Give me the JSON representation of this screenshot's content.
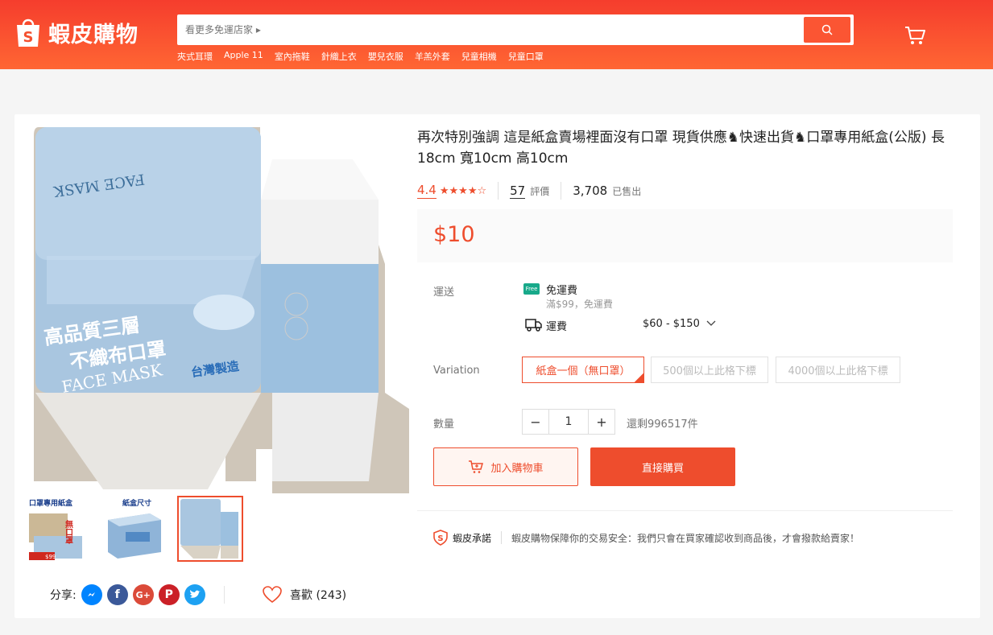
{
  "header": {
    "brand_name": "蝦皮購物",
    "search_placeholder": "看更多免運店家 ▸",
    "hot_words": [
      "夾式耳環",
      "Apple 11",
      "室內拖鞋",
      "針織上衣",
      "嬰兒衣服",
      "羊羔外套",
      "兒童相機",
      "兒童口罩"
    ],
    "brand_color": "#ee4d2d"
  },
  "product": {
    "title": "再次特別強調 這是紙盒賣場裡面沒有口罩 現貨供應♞快速出貨♞口罩專用紙盒(公版) 長18cm 寬10cm 高10cm",
    "rating": "4.4",
    "stars": "★★★★☆",
    "review_count": "57",
    "review_label": "評價",
    "sold_count": "3,708",
    "sold_label": "已售出",
    "price": "$10",
    "image_texts": {
      "face_mask": "FACE MASK",
      "high_quality": "高品質三層",
      "non_woven": "不織布口罩",
      "made_in_taiwan": "台灣製造"
    },
    "thumbnails": [
      {
        "line1": "口罩專用紙盒",
        "line2": "無口罩",
        "price_tag": "$99"
      },
      {
        "line1": "紙盒尺寸"
      },
      {
        "line1": ""
      }
    ]
  },
  "shipping": {
    "label": "運送",
    "free_badge": "Free",
    "free_text": "免運費",
    "free_sub": "滿$99，免運費",
    "fee_label": "運費",
    "fee_range": "$60 - $150"
  },
  "variation": {
    "label": "Variation",
    "options": [
      "紙盒一個（無口罩）",
      "500個以上此格下標",
      "4000個以上此格下標"
    ],
    "selected": 0
  },
  "quantity": {
    "label": "數量",
    "minus": "−",
    "value": "1",
    "plus": "+",
    "stock": "還剩996517件"
  },
  "actions": {
    "add_to_cart": "加入購物車",
    "buy_now": "直接購買"
  },
  "guarantee": {
    "label": "蝦皮承諾",
    "text": "蝦皮購物保障你的交易安全：我們只會在買家確認收到商品後，才會撥款給賣家！"
  },
  "social": {
    "share_label": "分享:",
    "networks": [
      "messenger",
      "facebook",
      "google-plus",
      "pinterest",
      "twitter"
    ],
    "like_label": "喜歡 (243)"
  }
}
